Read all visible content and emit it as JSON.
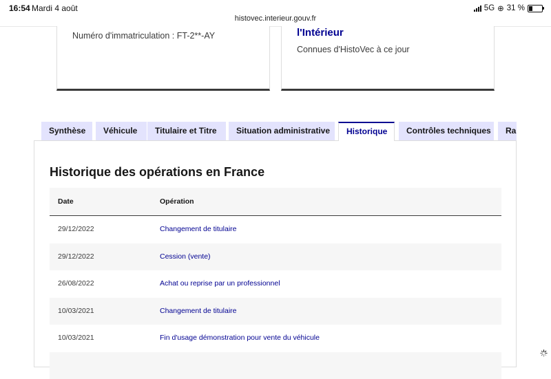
{
  "status_bar": {
    "time": "16:54",
    "date": "Mardi 4 août",
    "url": "histovec.interieur.gouv.fr",
    "network": "5G",
    "battery": "31 %"
  },
  "cards": {
    "plate": "Numéro d'immatriculation : FT-2**-AY",
    "title": "l'Intérieur",
    "subtitle": "Connues d'HistoVec à ce jour"
  },
  "tabs": [
    {
      "label": "Synthèse"
    },
    {
      "label": "Véhicule"
    },
    {
      "label": "Titulaire et Titre"
    },
    {
      "label": "Situation administrative"
    },
    {
      "label": "Historique"
    },
    {
      "label": "Contrôles techniques"
    },
    {
      "label": "Rapport"
    }
  ],
  "active_tab": "Historique",
  "section": {
    "title": "Historique des opérations en France",
    "columns": [
      "Date",
      "Opération"
    ],
    "rows": [
      {
        "date": "29/12/2022",
        "operation": "Changement de titulaire"
      },
      {
        "date": "29/12/2022",
        "operation": "Cession (vente)"
      },
      {
        "date": "26/08/2022",
        "operation": "Achat ou reprise par un professionnel"
      },
      {
        "date": "10/03/2021",
        "operation": "Changement de titulaire"
      },
      {
        "date": "10/03/2021",
        "operation": "Fin d'usage démonstration pour vente du véhicule"
      }
    ]
  },
  "colors": {
    "accent": "#000091",
    "tab_background": "#e3e3fd",
    "row_alt": "#f6f6f6"
  }
}
